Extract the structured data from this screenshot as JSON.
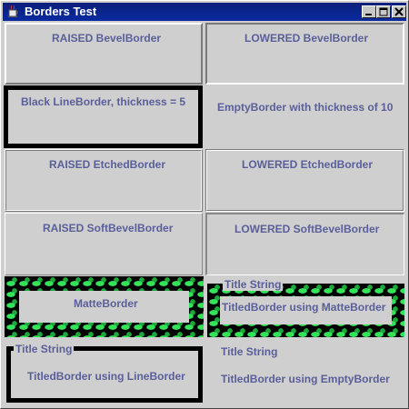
{
  "window": {
    "title": "Borders Test",
    "minimize_label": "minimize",
    "maximize_label": "maximize",
    "close_label": "close"
  },
  "panels": {
    "raised_bevel": "RAISED BevelBorder",
    "lowered_bevel": "LOWERED BevelBorder",
    "line_border": "Black LineBorder, thickness = 5",
    "empty_border": "EmptyBorder with thickness of 10",
    "raised_etched": "RAISED EtchedBorder",
    "lowered_etched": "LOWERED EtchedBorder",
    "raised_soft": "RAISED SoftBevelBorder",
    "lowered_soft": "LOWERED SoftBevelBorder",
    "matte": "MatteBorder",
    "titled_matte_title": "Title String",
    "titled_matte": "TitledBorder using MatteBorder",
    "titled_line_title": "Title String",
    "titled_line": "TitledBorder using LineBorder",
    "titled_empty_title": "Title String",
    "titled_empty": "TitledBorder using EmptyBorder"
  },
  "colors": {
    "titlebar": "#0a2aa0",
    "label_text": "#5a5f9a",
    "background": "#cfcfcf",
    "matte_pattern": "#35e35a"
  }
}
